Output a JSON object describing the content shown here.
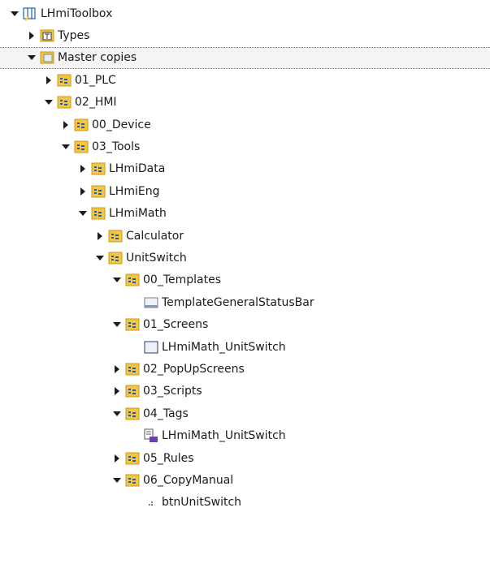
{
  "tree": {
    "nodes": [
      {
        "label": "LHmiToolbox",
        "depth": 0,
        "state": "expanded",
        "icon": "library-icon",
        "selected": false
      },
      {
        "label": "Types",
        "depth": 1,
        "state": "collapsed",
        "icon": "types-folder-icon",
        "selected": false
      },
      {
        "label": "Master copies",
        "depth": 1,
        "state": "expanded",
        "icon": "master-copies-folder-icon",
        "selected": true
      },
      {
        "label": "01_PLC",
        "depth": 2,
        "state": "collapsed",
        "icon": "folder-icon",
        "selected": false
      },
      {
        "label": "02_HMI",
        "depth": 2,
        "state": "expanded",
        "icon": "folder-icon",
        "selected": false
      },
      {
        "label": "00_Device",
        "depth": 3,
        "state": "collapsed",
        "icon": "folder-icon",
        "selected": false
      },
      {
        "label": "03_Tools",
        "depth": 3,
        "state": "expanded",
        "icon": "folder-icon",
        "selected": false
      },
      {
        "label": "LHmiData",
        "depth": 4,
        "state": "collapsed",
        "icon": "folder-icon",
        "selected": false
      },
      {
        "label": "LHmiEng",
        "depth": 4,
        "state": "collapsed",
        "icon": "folder-icon",
        "selected": false
      },
      {
        "label": "LHmiMath",
        "depth": 4,
        "state": "expanded",
        "icon": "folder-icon",
        "selected": false
      },
      {
        "label": "Calculator",
        "depth": 5,
        "state": "collapsed",
        "icon": "folder-icon",
        "selected": false
      },
      {
        "label": "UnitSwitch",
        "depth": 5,
        "state": "expanded",
        "icon": "folder-icon",
        "selected": false
      },
      {
        "label": "00_Templates",
        "depth": 6,
        "state": "expanded",
        "icon": "folder-icon",
        "selected": false
      },
      {
        "label": "TemplateGeneralStatusBar",
        "depth": 7,
        "state": "none",
        "icon": "template-icon",
        "selected": false
      },
      {
        "label": "01_Screens",
        "depth": 6,
        "state": "expanded",
        "icon": "folder-icon",
        "selected": false
      },
      {
        "label": "LHmiMath_UnitSwitch",
        "depth": 7,
        "state": "none",
        "icon": "screen-icon",
        "selected": false
      },
      {
        "label": "02_PopUpScreens",
        "depth": 6,
        "state": "collapsed",
        "icon": "folder-icon",
        "selected": false
      },
      {
        "label": "03_Scripts",
        "depth": 6,
        "state": "collapsed",
        "icon": "folder-icon",
        "selected": false
      },
      {
        "label": "04_Tags",
        "depth": 6,
        "state": "expanded",
        "icon": "folder-icon",
        "selected": false
      },
      {
        "label": "LHmiMath_UnitSwitch",
        "depth": 7,
        "state": "none",
        "icon": "tag-table-icon",
        "selected": false
      },
      {
        "label": "05_Rules",
        "depth": 6,
        "state": "collapsed",
        "icon": "folder-icon",
        "selected": false
      },
      {
        "label": "06_CopyManual",
        "depth": 6,
        "state": "expanded",
        "icon": "folder-icon",
        "selected": false
      },
      {
        "label": "btnUnitSwitch",
        "depth": 7,
        "state": "none",
        "icon": "button-element-icon",
        "selected": false
      }
    ]
  },
  "colors": {
    "folder_yellow": "#f5c542",
    "folder_border": "#c89a1a",
    "icon_blue": "#1f5fa8",
    "selection_bg": "#f4f4f4",
    "screen_purple": "#6a3fb5"
  }
}
